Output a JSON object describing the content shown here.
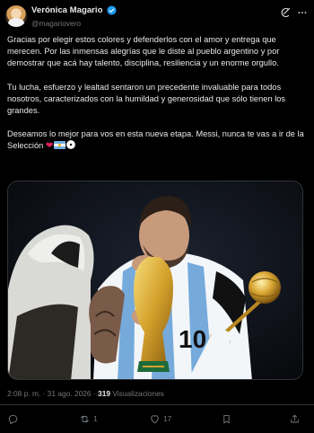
{
  "author": {
    "display_name": "Verónica Magario",
    "handle": "@magariovero",
    "verified": true
  },
  "tweet": {
    "paragraphs": [
      "Gracias por elegir estos colores y defenderlos con el amor y entrega que merecen. Por las inmensas alegrías que le diste al pueblo argentino y por demostrar que acá hay talento, disciplina, resiliencia y un enorme orgullo.",
      "Tu lucha, esfuerzo y lealtad sentaron un precedente invaluable para todos nosotros, caracterizados con la humildad y generosidad que sólo tienen los grandes."
    ],
    "last_paragraph": "Deseamos lo mejor para vos en esta nueva etapa. Messi, nunca te vas a ir de la Selección",
    "emojis": [
      "red-heart",
      "argentina-flag",
      "soccer-ball"
    ]
  },
  "meta": {
    "time_date": "2:08 p. m. · 31 ago. 2026 · ",
    "views_count": "319",
    "views_label": " Visualizaciones"
  },
  "actions": {
    "reply_count": "",
    "retweet_count": "1",
    "like_count": "17"
  },
  "icons": {
    "header": [
      "grok-icon",
      "more-icon"
    ],
    "actions": [
      "reply-icon",
      "retweet-icon",
      "like-icon",
      "bookmark-icon",
      "share-icon"
    ]
  },
  "colors": {
    "background": "#000000",
    "text": "#e7e9ea",
    "secondary_text": "#71767b",
    "verified": "#1d9bf0",
    "border": "#2f3336"
  }
}
